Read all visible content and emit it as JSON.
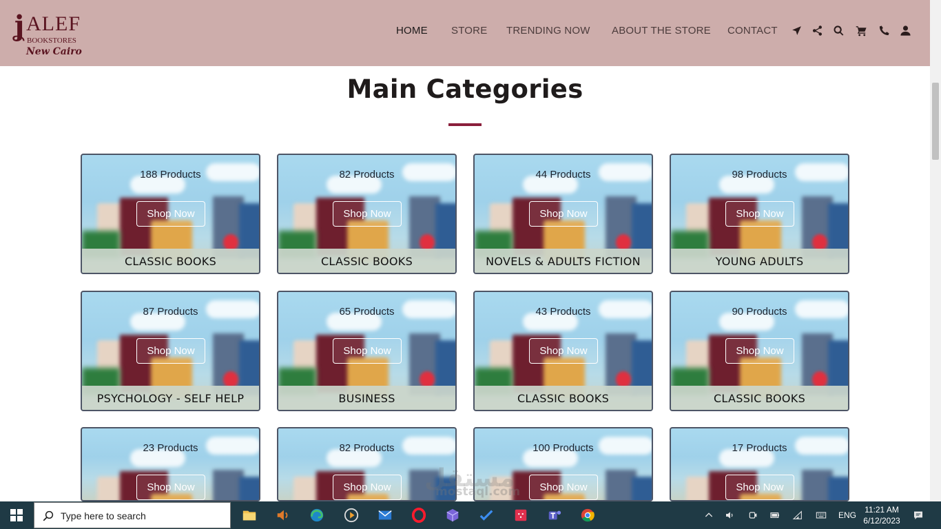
{
  "header": {
    "logo": {
      "brand": "ALEF",
      "sub": "BOOKSTORES",
      "city": "New Cairo"
    },
    "nav": [
      {
        "label": "HOME",
        "active": true
      },
      {
        "label": "STORE",
        "active": false
      },
      {
        "label": "TRENDING NOW",
        "active": false
      },
      {
        "label": "ABOUT THE STORE",
        "active": false
      },
      {
        "label": "CONTACT",
        "active": false
      }
    ],
    "icons": [
      "location-arrow-icon",
      "share-icon",
      "search-icon",
      "cart-icon",
      "phone-icon",
      "user-icon"
    ]
  },
  "main": {
    "title": "Main Categories",
    "accent_color": "#8a1f3b",
    "categories": [
      {
        "count": "188 Products",
        "button": "Shop Now",
        "name": "CLASSIC BOOKS"
      },
      {
        "count": "82 Products",
        "button": "Shop Now",
        "name": "CLASSIC BOOKS"
      },
      {
        "count": "44 Products",
        "button": "Shop Now",
        "name": "NOVELS & ADULTS FICTION"
      },
      {
        "count": "98 Products",
        "button": "Shop Now",
        "name": "YOUNG ADULTS"
      },
      {
        "count": "87 Products",
        "button": "Shop Now",
        "name": "PSYCHOLOGY - SELF HELP"
      },
      {
        "count": "65 Products",
        "button": "Shop Now",
        "name": "BUSINESS"
      },
      {
        "count": "43 Products",
        "button": "Shop Now",
        "name": "CLASSIC BOOKS"
      },
      {
        "count": "90 Products",
        "button": "Shop Now",
        "name": "CLASSIC BOOKS"
      },
      {
        "count": "23 Products",
        "button": "Shop Now",
        "name": ""
      },
      {
        "count": "82 Products",
        "button": "Shop Now",
        "name": ""
      },
      {
        "count": "100 Products",
        "button": "Shop Now",
        "name": ""
      },
      {
        "count": "17 Products",
        "button": "Shop Now",
        "name": ""
      }
    ]
  },
  "watermark": {
    "arabic": "مستقل",
    "latin": "mostaql.com"
  },
  "taskbar": {
    "search_placeholder": "Type here to search",
    "apps": [
      "file-explorer-icon",
      "speaker-app-icon",
      "edge-icon",
      "media-player-icon",
      "mail-icon",
      "opera-icon",
      "app-cube-icon",
      "todo-icon",
      "calendar-app-icon",
      "teams-icon",
      "chrome-icon"
    ],
    "language": "ENG",
    "time": "11:21 AM",
    "date": "6/12/2023"
  }
}
